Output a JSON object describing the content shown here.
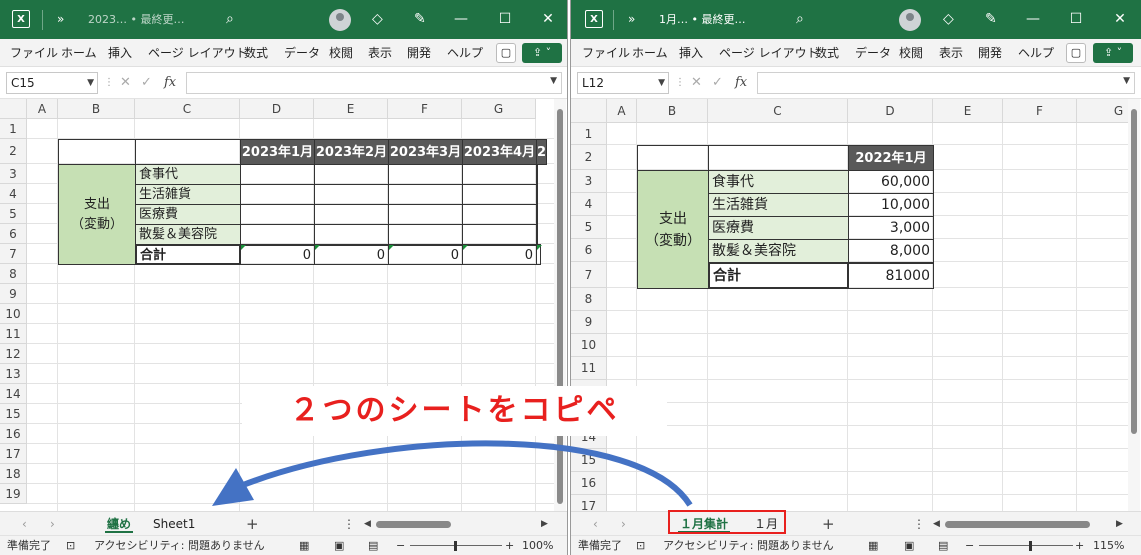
{
  "left": {
    "title": "2023… • 最終更…",
    "cell_ref": "C15",
    "tabs": [
      "纏め",
      "Sheet1"
    ],
    "active_tab": 0,
    "cols": [
      "A",
      "B",
      "C",
      "D",
      "E",
      "F",
      "G"
    ],
    "rows": [
      "1",
      "2",
      "3",
      "4",
      "5",
      "6",
      "7",
      "8",
      "9",
      "10",
      "11",
      "12",
      "13",
      "14",
      "15",
      "16",
      "17",
      "18",
      "19"
    ],
    "months": [
      "2023年1月",
      "2023年2月",
      "2023年3月",
      "2023年4月",
      "2"
    ],
    "group_label": "支出\n（変動）",
    "items": [
      "食事代",
      "生活雑貨",
      "医療費",
      "散髪＆美容院"
    ],
    "total_label": "合計",
    "totals": [
      "0",
      "0",
      "0",
      "0",
      ""
    ],
    "status_ready": "準備完了",
    "status_accessibility": "アクセシビリティ: 問題ありません",
    "zoom": "100%"
  },
  "right": {
    "title": "1月… • 最終更…",
    "cell_ref": "L12",
    "tabs": [
      "１月集計",
      "１月"
    ],
    "active_tab": 0,
    "cols": [
      "A",
      "B",
      "C",
      "D",
      "E",
      "F",
      "G"
    ],
    "rows": [
      "1",
      "2",
      "3",
      "4",
      "5",
      "6",
      "7",
      "8",
      "9",
      "10",
      "11",
      "12",
      "13",
      "14",
      "15",
      "16",
      "17"
    ],
    "month": "2022年1月",
    "group_label": "支出\n（変動）",
    "items": [
      "食事代",
      "生活雑貨",
      "医療費",
      "散髪＆美容院"
    ],
    "values": [
      "60,000",
      "10,000",
      "3,000",
      "8,000"
    ],
    "total_label": "合計",
    "total": "81000",
    "status_ready": "準備完了",
    "status_accessibility": "アクセシビリティ: 問題ありません",
    "zoom": "115%"
  },
  "menu": [
    "ファイル",
    "ホーム",
    "挿入",
    "ページ レイアウト",
    "数式",
    "データ",
    "校閲",
    "表示",
    "開発",
    "ヘルプ"
  ],
  "chevron": "»",
  "overlay": "２つのシートをコピペ",
  "colors": {
    "excel_green": "#1f7244",
    "header_dark": "#595959",
    "group_green": "#c6e0b4",
    "item_green": "#e2efda",
    "annotation_red": "#e8201e",
    "arrow_blue": "#4472c4"
  }
}
